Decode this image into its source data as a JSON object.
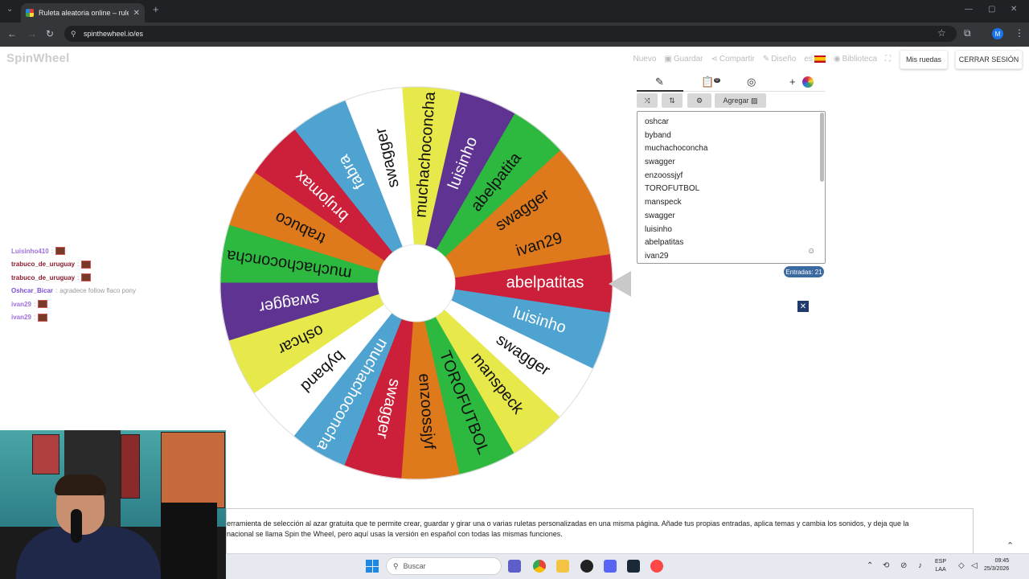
{
  "browser": {
    "tab_title": "Ruleta aleatoria online – ruleta",
    "tab_close": "✕",
    "new_tab": "+",
    "url": "spinthewheel.io/es",
    "back": "←",
    "forward": "→",
    "reload": "↻",
    "bookmark": "☆",
    "extensions": "⧉",
    "profile": "M",
    "menu": "⋮",
    "minimize": "—",
    "restore": "▢",
    "close": "✕",
    "tab_list": "⌄"
  },
  "site": {
    "logo": "SpinWheel",
    "nav": {
      "nuevo": "Nuevo",
      "guardar": "Guardar",
      "compartir": "Compartir",
      "diseno": "Diseño",
      "lang": "es",
      "biblioteca": "Biblioteca"
    },
    "mis_ruedas": "Mis ruedas",
    "cerrar_sesion": "CERRAR SESIÓN"
  },
  "wheel": {
    "segments": [
      {
        "label": "swagger",
        "color": "#DE7A1B",
        "text": "#111"
      },
      {
        "label": "abelpatita",
        "color": "#2DB93F",
        "text": "#111"
      },
      {
        "label": "luisinho",
        "color": "#5E3391",
        "text": "#fff"
      },
      {
        "label": "muchachoconcha",
        "color": "#E7E849",
        "text": "#111"
      },
      {
        "label": "swagger",
        "color": "#FFFFFF",
        "text": "#111"
      },
      {
        "label": "fabra",
        "color": "#4FA3D1",
        "text": "#fff"
      },
      {
        "label": "brujomax",
        "color": "#CC1F39",
        "text": "#fff"
      },
      {
        "label": "trabuco",
        "color": "#DE7A1B",
        "text": "#111"
      },
      {
        "label": "muchachoconcha",
        "color": "#2DB93F",
        "text": "#111"
      },
      {
        "label": "swagger",
        "color": "#5E3391",
        "text": "#fff"
      },
      {
        "label": "oshcar",
        "color": "#E7E849",
        "text": "#111"
      },
      {
        "label": "byband",
        "color": "#FFFFFF",
        "text": "#111"
      },
      {
        "label": "muchachoconcha",
        "color": "#4FA3D1",
        "text": "#fff"
      },
      {
        "label": "swagger",
        "color": "#CC1F39",
        "text": "#fff"
      },
      {
        "label": "enzoossjyf",
        "color": "#DE7A1B",
        "text": "#111"
      },
      {
        "label": "TOROFUTBOL",
        "color": "#2DB93F",
        "text": "#111"
      },
      {
        "label": "manspeck",
        "color": "#E7E849",
        "text": "#111"
      },
      {
        "label": "swagger",
        "color": "#FFFFFF",
        "text": "#111"
      },
      {
        "label": "luisinho",
        "color": "#4FA3D1",
        "text": "#fff"
      },
      {
        "label": "abelpatitas",
        "color": "#CC1F39",
        "text": "#fff"
      },
      {
        "label": "ivan29",
        "color": "#DE7A1B",
        "text": "#111"
      }
    ]
  },
  "panel": {
    "tab_edit_icon": "✎",
    "tab_results_icon": "📋",
    "tab_results_badge": "0",
    "tab_hide_icon": "◎",
    "tab_add_icon": "+",
    "shuffle": "⤨",
    "sort": "⇅",
    "settings": "⚙",
    "agregar": "Agregar",
    "entries": [
      "oshcar",
      "byband",
      "muchachoconcha",
      "swagger",
      "enzoossjyf",
      "TOROFUTBOL",
      "manspeck",
      "swagger",
      "luisinho",
      "abelpatitas",
      "ivan29"
    ],
    "entries_count": "Entradas: 21",
    "emoji": "☺",
    "close": "✕"
  },
  "chat": [
    {
      "user": "Luisinho410",
      "text": "",
      "color": "#a070e0",
      "emote": true
    },
    {
      "user": "trabuco_de_uruguay",
      "text": "",
      "color": "#8a1a2a",
      "emote": true
    },
    {
      "user": "trabuco_de_uruguay",
      "text": "",
      "color": "#8a1a2a",
      "emote": true
    },
    {
      "user": "Oshcar_Bicar",
      "text": "agradece follow flaco pony",
      "color": "#7b4dd6",
      "emote": false
    },
    {
      "user": "ivan29",
      "text": "",
      "color": "#a070e0",
      "emote": true
    },
    {
      "user": "ivan29",
      "text": "",
      "color": "#a070e0",
      "emote": true
    }
  ],
  "description": {
    "line1": "erramienta de selección al azar gratuita que te permite crear, guardar y girar una o varias ruletas personalizadas en una misma página. Añade tus propias entradas, aplica temas y cambia los sonidos, y deja que la",
    "line2": "nacional se llama Spin the Wheel, pero aquí usas la versión en español con todas las mismas funciones."
  },
  "taskbar": {
    "search": "Buscar",
    "lang1": "ESP",
    "lang2": "LAA",
    "time": "09:45",
    "date": "25/3/2026"
  }
}
